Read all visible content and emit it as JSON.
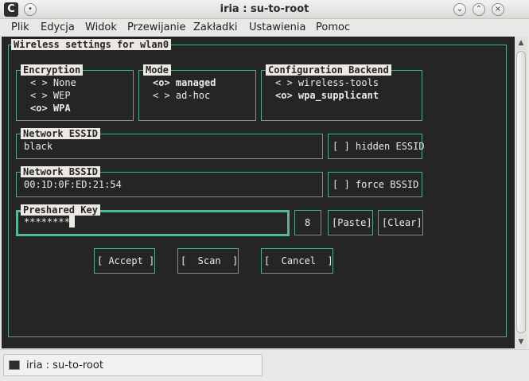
{
  "window": {
    "title": "iria : su-to-root",
    "app_icon": "C",
    "icons": [
      "chevron-down-icon",
      "chevron-up-icon",
      "close-icon"
    ]
  },
  "menu": [
    "Plik",
    "Edycja",
    "Widok",
    "Przewijanie",
    "Zakładki",
    "Ustawienia",
    "Pomoc"
  ],
  "dialog": {
    "title": "Wireless settings for wlan0",
    "encryption": {
      "title": "Encryption",
      "options": [
        "< > None",
        "< > WEP",
        "<o> WPA"
      ],
      "selected": 2
    },
    "mode": {
      "title": "Mode",
      "options": [
        "<o> managed",
        "< > ad-hoc"
      ],
      "selected": 0
    },
    "backend": {
      "title": "Configuration Backend",
      "options": [
        "< > wireless-tools",
        "<o> wpa_supplicant"
      ],
      "selected": 1
    },
    "essid": {
      "title": "Network ESSID",
      "value": "black",
      "hidden_label": "[ ] hidden ESSID"
    },
    "bssid": {
      "title": "Network BSSID",
      "value": "00:1D:0F:ED:21:54",
      "force_label": "[ ] force BSSID"
    },
    "psk": {
      "title": "Preshared Key",
      "value": "********",
      "length": "8",
      "paste_label": "[Paste]",
      "clear_label": "[Clear]"
    },
    "buttons": {
      "accept": "[ Accept ]",
      "scan": "[  Scan  ]",
      "cancel": "[  Cancel  ]"
    }
  },
  "tab": {
    "label": "iria : su-to-root"
  },
  "colors": {
    "terminal_bg": "#252525",
    "border": "#5da38a",
    "text": "#ece9e3"
  }
}
